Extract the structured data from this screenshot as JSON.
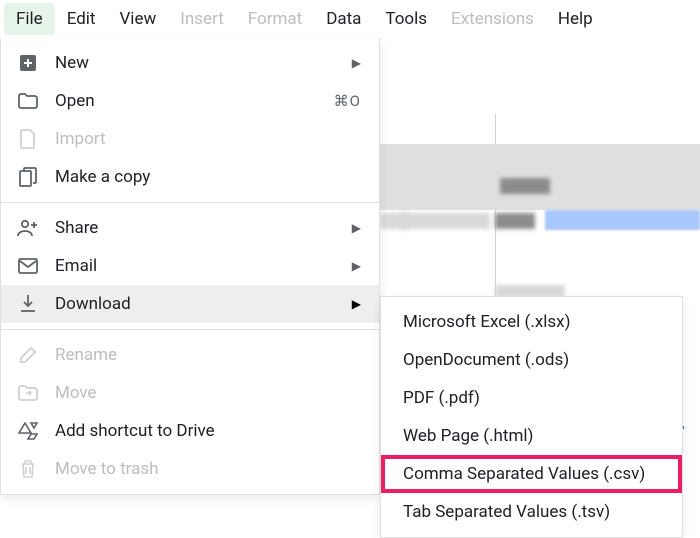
{
  "menubar": {
    "items": [
      {
        "label": "File",
        "active": true
      },
      {
        "label": "Edit"
      },
      {
        "label": "View"
      },
      {
        "label": "Insert",
        "disabled": true
      },
      {
        "label": "Format",
        "disabled": true
      },
      {
        "label": "Data"
      },
      {
        "label": "Tools"
      },
      {
        "label": "Extensions",
        "disabled": true
      },
      {
        "label": "Help"
      }
    ]
  },
  "file_menu": {
    "new": "New",
    "open": "Open",
    "open_shortcut": "⌘O",
    "import": "Import",
    "make_copy": "Make a copy",
    "share": "Share",
    "email": "Email",
    "download": "Download",
    "rename": "Rename",
    "move": "Move",
    "add_shortcut": "Add shortcut to Drive",
    "trash": "Move to trash"
  },
  "download_submenu": {
    "items": [
      {
        "label": "Microsoft Excel (.xlsx)"
      },
      {
        "label": "OpenDocument (.ods)"
      },
      {
        "label": "PDF (.pdf)"
      },
      {
        "label": "Web Page (.html)"
      },
      {
        "label": "Comma Separated Values (.csv)",
        "selected": true
      },
      {
        "label": "Tab Separated Values (.tsv)"
      }
    ]
  }
}
